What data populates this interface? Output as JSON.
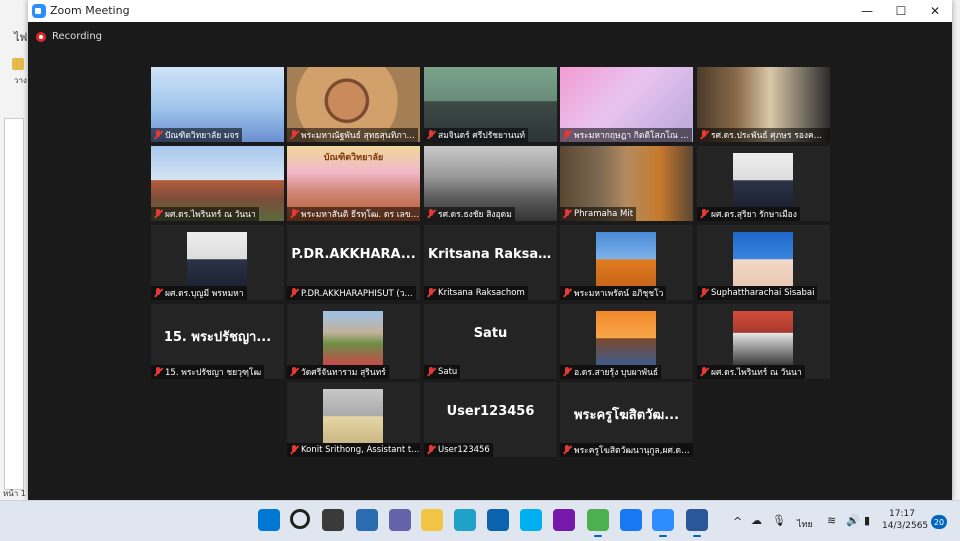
{
  "background_app": {
    "menu_fragment": "ไฟล",
    "side_fragment": "วาง",
    "page_label": "หน้า 1"
  },
  "window": {
    "title": "Zoom Meeting",
    "recording_label": "Recording",
    "controls": {
      "minimize": "—",
      "maximize": "☐",
      "close": "✕"
    }
  },
  "participants": [
    {
      "name": "ปัณฑิตวิทยาลัย มจร",
      "muted": true,
      "video": "poster"
    },
    {
      "name": "พระมหาณัฐพันธ์ สุทธสุนทิภา...",
      "muted": true,
      "video": "monk"
    },
    {
      "name": "สมจินดร์ ศรีปรัชยานนท์",
      "muted": true,
      "video": "office"
    },
    {
      "name": "พระมหากฤษฎา กิตติโสภโณ ...",
      "muted": true,
      "video": "pink"
    },
    {
      "name": "รศ.ดร.ประพันธ์ ศุภษร รองคณบดี",
      "muted": true,
      "video": "library"
    },
    {
      "name": "ผศ.ดร.ไพรินทร์ ณ วันนา",
      "muted": true,
      "video": "temple"
    },
    {
      "name": "พระมหาสันติ ธีรทฺโฒ. ดร เลขานุ...",
      "muted": true,
      "video": "monk-banner",
      "active": true,
      "banner": "บัณฑิตวิทยาลัย"
    },
    {
      "name": "รศ.ดร.ธงชัย สิงอุดม",
      "muted": true,
      "video": "glasses"
    },
    {
      "name": "Phramaha Mit",
      "muted": true,
      "video": "monk-shelf"
    },
    {
      "name": "ผศ.ดร.สุริยา รักษาเมือง",
      "muted": true,
      "video": "portrait-suit"
    },
    {
      "name": "ผศ.ดร.บุญมี พรหมหา",
      "muted": true,
      "video": "portrait-suit"
    },
    {
      "name": "P.DR.AKKHARAPHISUT (ว...",
      "muted": true,
      "video": "none",
      "display": "P.DR.AKKHARA..."
    },
    {
      "name": "Kritsana Raksachom",
      "muted": true,
      "video": "none",
      "display": "Kritsana Raksac..."
    },
    {
      "name": "พระมหาเพรัตน์ อภิชฺชโว",
      "muted": true,
      "video": "portrait-monk"
    },
    {
      "name": "Suphattharachai Sisabai",
      "muted": true,
      "video": "portrait-blue"
    },
    {
      "name": "15. พระปรัชญา ชยวุฑฺโฒ",
      "muted": true,
      "video": "none",
      "display": "15. พระปรัชญา..."
    },
    {
      "name": "วัดศรีจันทาราม สุรินทร์",
      "muted": true,
      "video": "portrait-garden"
    },
    {
      "name": "Satu",
      "muted": true,
      "video": "none",
      "display": "Satu"
    },
    {
      "name": "อ.ดร.สายรุ้ง บุบผาพันธ์",
      "muted": true,
      "video": "portrait-orange"
    },
    {
      "name": "ผศ.ดร.ไพรินทร์ ณ วันนา",
      "muted": true,
      "video": "portrait-roof"
    },
    {
      "name": "Konit Srithong, Assistant t...",
      "muted": true,
      "video": "portrait-grey"
    },
    {
      "name": "User123456",
      "muted": true,
      "video": "none",
      "display": "User123456"
    },
    {
      "name": "พระครูโฆสิตวัฒนานุกูล,ผศ.ดร....",
      "muted": true,
      "video": "none",
      "display": "พระครูโฆสิตวัฒ..."
    }
  ],
  "taskbar": {
    "apps": [
      "windows-start",
      "search",
      "task-view",
      "widgets",
      "teams-chat",
      "file-explorer",
      "edge",
      "mail",
      "skype",
      "onenote",
      "teams",
      "facebook",
      "zoom",
      "word"
    ],
    "tray": {
      "language": "ไทย",
      "time": "17:17",
      "date": "14/3/2565",
      "notifications": "20"
    }
  },
  "colors": {
    "tile_bg": "#242424",
    "active_border": "#d9dc3a",
    "muted_mic": "#e53935",
    "zoom_blue": "#2d8cff"
  }
}
